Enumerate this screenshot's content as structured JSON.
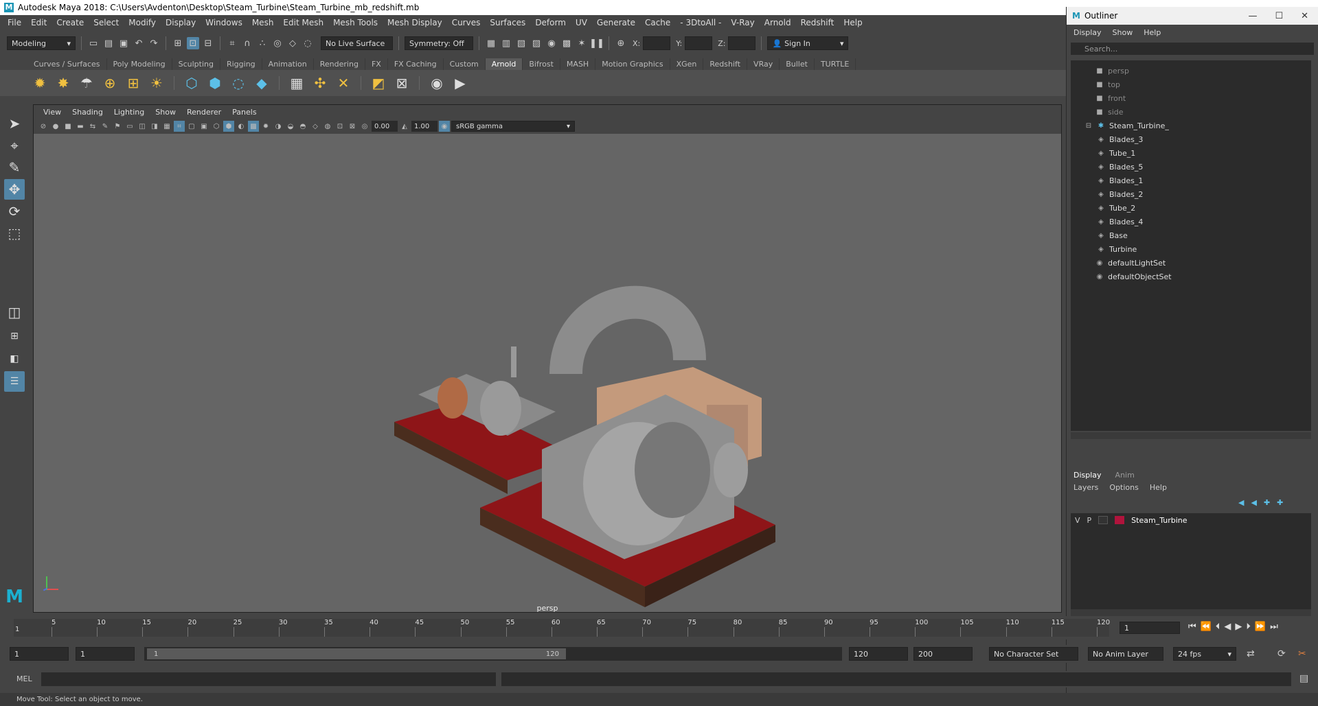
{
  "window": {
    "title": "Autodesk Maya 2018: C:\\Users\\Avdenton\\Desktop\\Steam_Turbine\\Steam_Turbine_mb_redshift.mb"
  },
  "menubar": [
    "File",
    "Edit",
    "Create",
    "Select",
    "Modify",
    "Display",
    "Windows",
    "Mesh",
    "Edit Mesh",
    "Mesh Tools",
    "Mesh Display",
    "Curves",
    "Surfaces",
    "Deform",
    "UV",
    "Generate",
    "Cache",
    "- 3DtoAll -",
    "V-Ray",
    "Arnold",
    "Redshift",
    "Help"
  ],
  "statusline": {
    "mode": "Modeling",
    "live_surface": "No Live Surface",
    "symmetry": "Symmetry: Off",
    "x_label": "X:",
    "y_label": "Y:",
    "z_label": "Z:",
    "sign_in": "Sign In"
  },
  "shelf_tabs": [
    "Curves / Surfaces",
    "Poly Modeling",
    "Sculpting",
    "Rigging",
    "Animation",
    "Rendering",
    "FX",
    "FX Caching",
    "Custom",
    "Arnold",
    "Bifrost",
    "MASH",
    "Motion Graphics",
    "XGen",
    "Redshift",
    "VRay",
    "Bullet",
    "TURTLE"
  ],
  "shelf_active": "Arnold",
  "viewport": {
    "menu": [
      "View",
      "Shading",
      "Lighting",
      "Show",
      "Renderer",
      "Panels"
    ],
    "exposure": "0.00",
    "gamma": "1.00",
    "color_space": "sRGB gamma",
    "camera_label": "persp"
  },
  "outliner": {
    "title": "Outliner",
    "menu": [
      "Display",
      "Show",
      "Help"
    ],
    "search_placeholder": "Search...",
    "cameras": [
      "persp",
      "top",
      "front",
      "side"
    ],
    "group": "Steam_Turbine_",
    "children": [
      "Blades_3",
      "Tube_1",
      "Blades_5",
      "Blades_1",
      "Blades_2",
      "Tube_2",
      "Blades_4",
      "Base",
      "Turbine"
    ],
    "sets": [
      "defaultLightSet",
      "defaultObjectSet"
    ]
  },
  "layer_editor": {
    "tabs": [
      "Display",
      "Anim"
    ],
    "menu": [
      "Layers",
      "Options",
      "Help"
    ],
    "layer": {
      "v": "V",
      "p": "P",
      "name": "Steam_Turbine",
      "color": "#b0143c"
    }
  },
  "timeline": {
    "ticks": [
      "5",
      "10",
      "15",
      "20",
      "25",
      "30",
      "35",
      "40",
      "45",
      "50",
      "55",
      "60",
      "65",
      "70",
      "75",
      "80",
      "85",
      "90",
      "95",
      "100",
      "105",
      "110",
      "115",
      "120"
    ],
    "start_tick": "1",
    "current_frame": "1"
  },
  "range": {
    "start": "1",
    "playback_start": "1",
    "slider_start": "1",
    "slider_end": "120",
    "playback_end": "120",
    "end": "200",
    "character_set": "No Character Set",
    "anim_layer": "No Anim Layer",
    "fps": "24 fps"
  },
  "cmdline": {
    "label": "MEL"
  },
  "helpline": {
    "text": "Move Tool: Select an object to move."
  },
  "colors": {
    "accent": "#5285a6",
    "base_red": "#8e1518",
    "base_wood": "#4a2d1e",
    "copper": "#c49a7c"
  }
}
